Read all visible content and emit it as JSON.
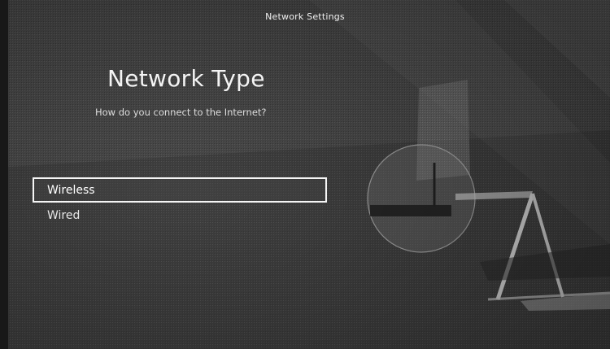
{
  "header": {
    "title": "Network Settings"
  },
  "main": {
    "heading": "Network Type",
    "prompt": "How do you connect to the Internet?",
    "options": [
      {
        "label": "Wireless",
        "selected": true
      },
      {
        "label": "Wired",
        "selected": false
      }
    ]
  }
}
